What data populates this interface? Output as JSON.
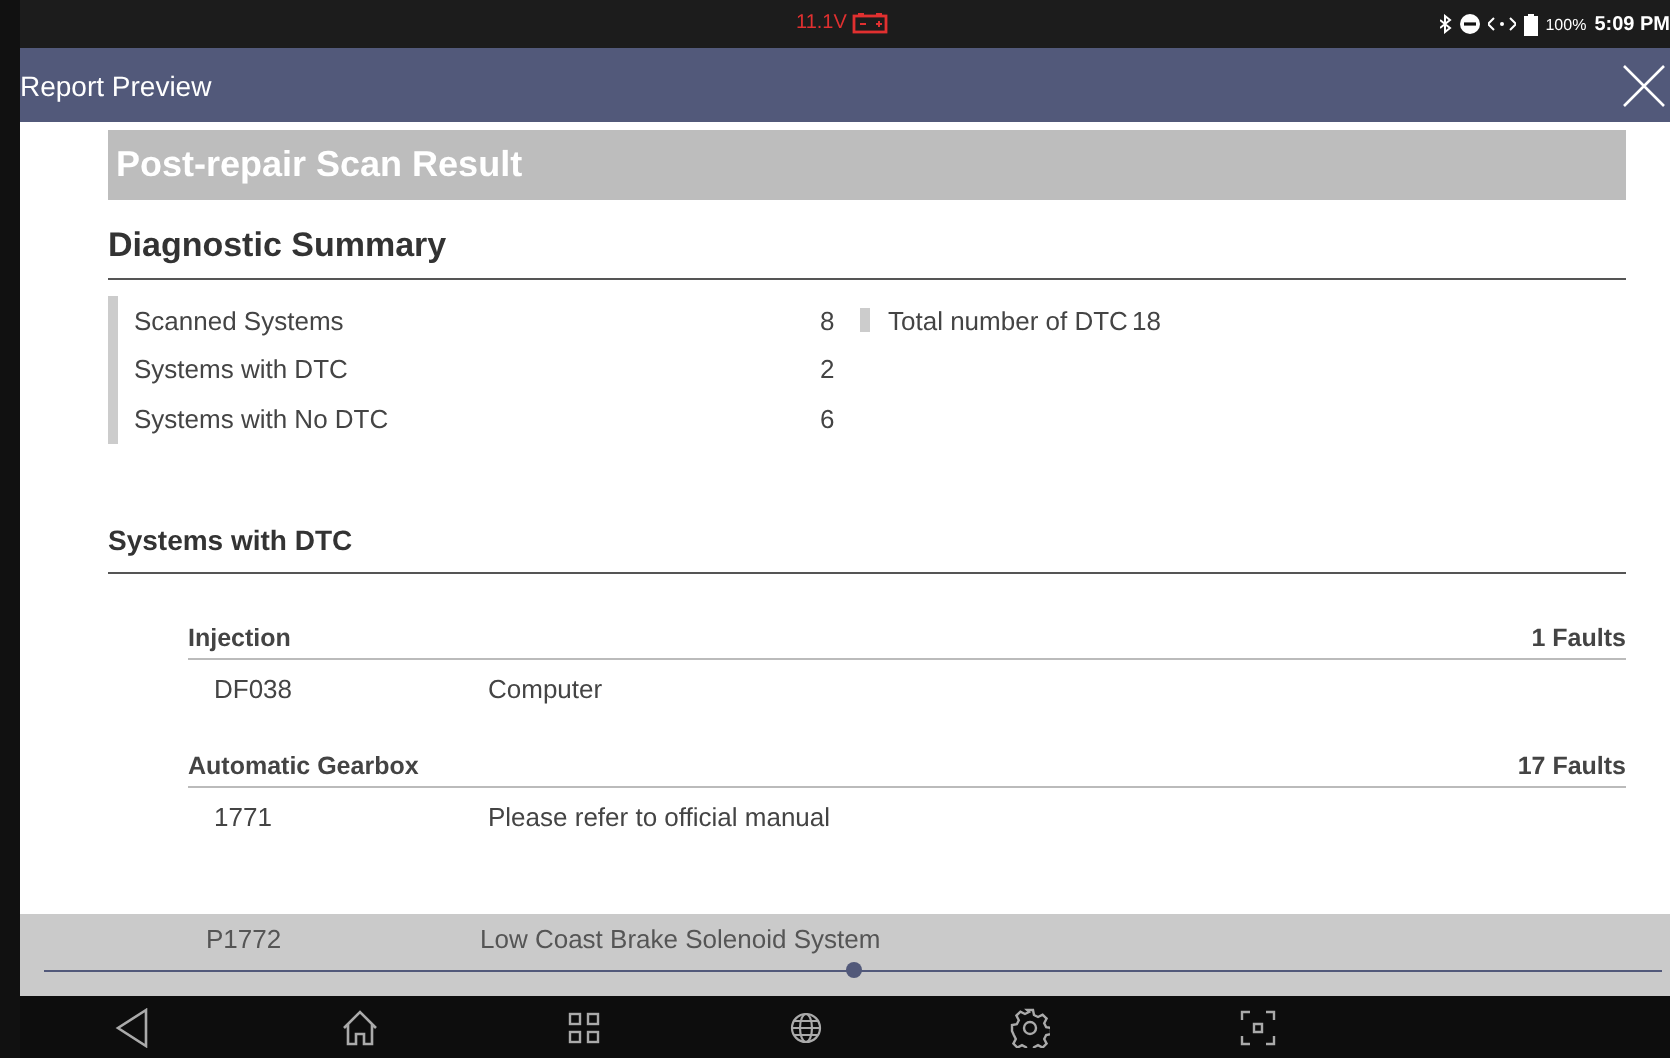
{
  "status_bar": {
    "voltage": "11.1V",
    "battery": "100%",
    "time": "5:09 PM"
  },
  "window": {
    "title": "Report Preview"
  },
  "report": {
    "banner": "Post-repair Scan Result",
    "summary_title": "Diagnostic Summary",
    "summary": [
      {
        "label": "Scanned Systems",
        "value": "8"
      },
      {
        "label": "Systems with DTC",
        "value": "2"
      },
      {
        "label": "Systems with No DTC",
        "value": "6"
      }
    ],
    "total": {
      "label": "Total number of DTC",
      "value": "18"
    },
    "systems_title": "Systems with DTC",
    "systems": [
      {
        "name": "Injection",
        "faults": "1 Faults",
        "codes": [
          {
            "code": "DF038",
            "description": "Computer"
          }
        ]
      },
      {
        "name": "Automatic Gearbox",
        "faults": "17 Faults",
        "codes": [
          {
            "code": "1771",
            "description": "Please refer to official manual"
          }
        ]
      }
    ]
  },
  "page_slider": {
    "level": 0.5,
    "row": {
      "code": "P1772",
      "description": "Low Coast Brake Solenoid System"
    }
  }
}
